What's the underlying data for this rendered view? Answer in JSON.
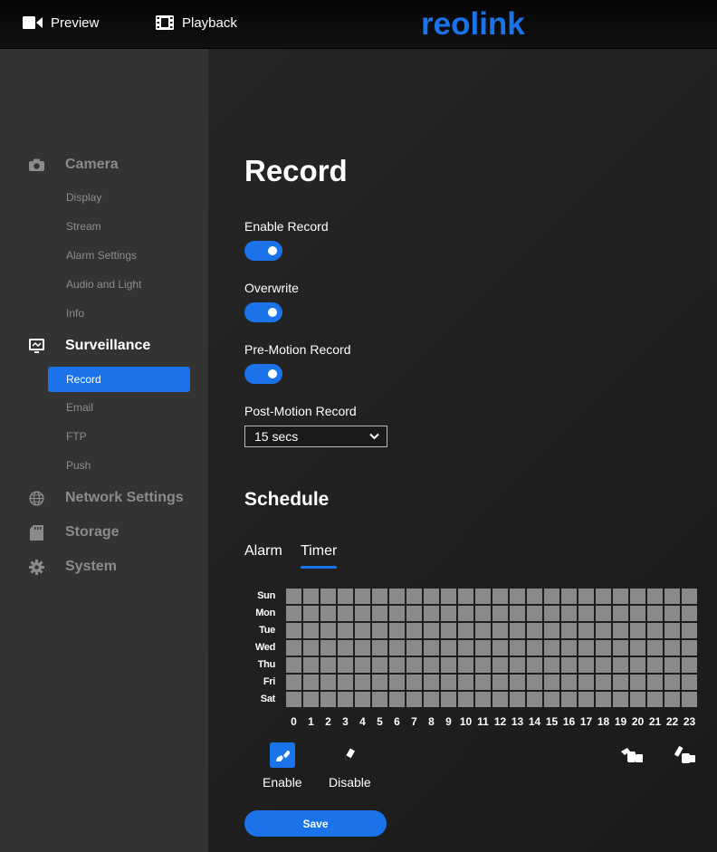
{
  "topbar": {
    "preview_label": "Preview",
    "playback_label": "Playback",
    "logo_text": "reolink",
    "logo_color": "#1a73e8"
  },
  "sidebar": {
    "sections": [
      {
        "label": "Camera",
        "icon": "camera-icon",
        "items": [
          "Display",
          "Stream",
          "Alarm Settings",
          "Audio and Light",
          "Info"
        ]
      },
      {
        "label": "Surveillance",
        "icon": "monitor-icon",
        "items": [
          "Record",
          "Email",
          "FTP",
          "Push"
        ],
        "active_item": "Record"
      },
      {
        "label": "Network Settings",
        "icon": "globe-icon",
        "items": []
      },
      {
        "label": "Storage",
        "icon": "storage-icon",
        "items": []
      },
      {
        "label": "System",
        "icon": "gear-icon",
        "items": []
      }
    ]
  },
  "record": {
    "title": "Record",
    "enable_record": {
      "label": "Enable Record",
      "on": true
    },
    "overwrite": {
      "label": "Overwrite",
      "on": true
    },
    "pre_motion": {
      "label": "Pre-Motion Record",
      "on": true
    },
    "post_motion": {
      "label": "Post-Motion Record",
      "value": "15 secs"
    }
  },
  "schedule": {
    "title": "Schedule",
    "tabs": [
      "Alarm",
      "Timer"
    ],
    "active_tab": "Timer",
    "days": [
      "Sun",
      "Mon",
      "Tue",
      "Wed",
      "Thu",
      "Fri",
      "Sat"
    ],
    "hours": [
      "0",
      "1",
      "2",
      "3",
      "4",
      "5",
      "6",
      "7",
      "8",
      "9",
      "10",
      "11",
      "12",
      "13",
      "14",
      "15",
      "16",
      "17",
      "18",
      "19",
      "20",
      "21",
      "22",
      "23"
    ],
    "enable_label": "Enable",
    "disable_label": "Disable",
    "save_label": "Save"
  },
  "colors": {
    "accent": "#1a73e8",
    "cell": "#8a8a8a",
    "sidebar_bg": "#333333"
  }
}
